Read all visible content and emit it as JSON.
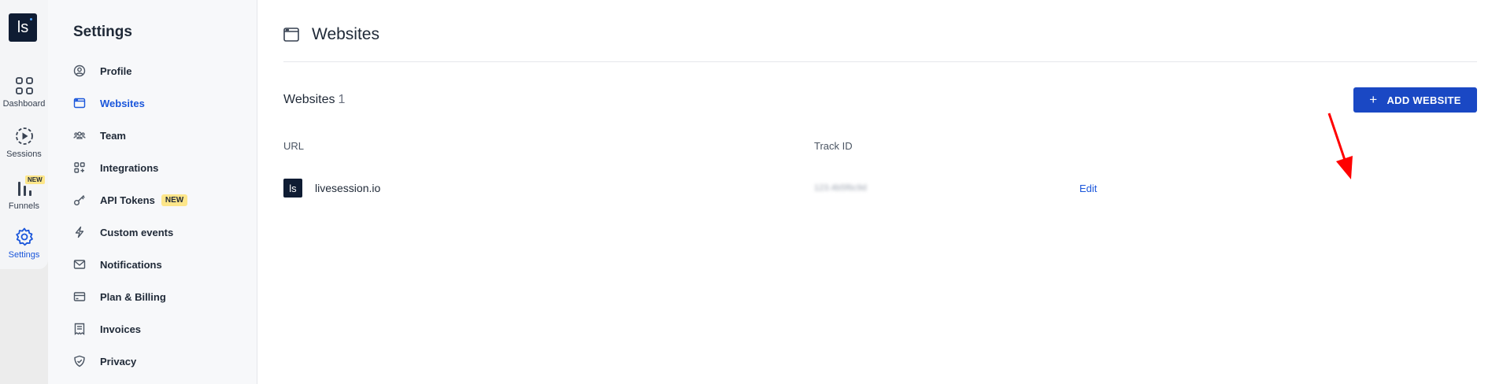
{
  "app": {
    "logo_text": "ls",
    "brand_color": "#0f1c33",
    "accent_color": "#1a56db"
  },
  "rail": {
    "items": [
      {
        "label": "Dashboard",
        "icon": "grid-icon"
      },
      {
        "label": "Sessions",
        "icon": "play-circle-icon"
      },
      {
        "label": "Funnels",
        "icon": "bar-chart-icon",
        "badge": "NEW"
      },
      {
        "label": "Settings",
        "icon": "gear-icon",
        "active": true
      }
    ]
  },
  "sidebar": {
    "title": "Settings",
    "items": [
      {
        "label": "Profile",
        "icon": "user-circle-icon"
      },
      {
        "label": "Websites",
        "icon": "browser-window-icon",
        "active": true
      },
      {
        "label": "Team",
        "icon": "team-icon"
      },
      {
        "label": "Integrations",
        "icon": "integrations-icon"
      },
      {
        "label": "API Tokens",
        "icon": "key-icon",
        "badge": "NEW"
      },
      {
        "label": "Custom events",
        "icon": "lightning-icon"
      },
      {
        "label": "Notifications",
        "icon": "envelope-icon"
      },
      {
        "label": "Plan & Billing",
        "icon": "credit-card-icon"
      },
      {
        "label": "Invoices",
        "icon": "invoice-icon"
      },
      {
        "label": "Privacy",
        "icon": "shield-check-icon"
      }
    ]
  },
  "main": {
    "page_title": "Websites",
    "section_title": "Websites",
    "section_count": "1",
    "add_button_label": "ADD WEBSITE",
    "columns": {
      "url": "URL",
      "track_id": "Track ID"
    },
    "rows": [
      {
        "logo_text": "ls",
        "url": "livesession.io",
        "track_id": "123.4b5f6c9d",
        "action": "Edit"
      }
    ]
  }
}
